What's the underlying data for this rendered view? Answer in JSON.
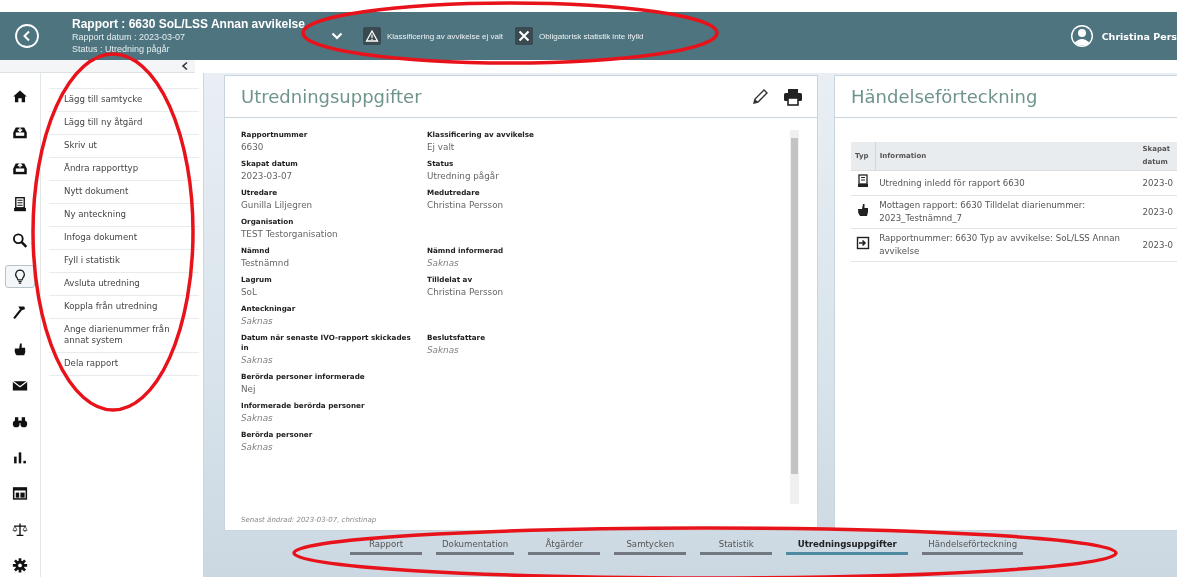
{
  "header": {
    "title": "Rapport : 6630 SoL/LSS Annan avvikelse",
    "subtitle_lines": [
      "Rapport datum : 2023-03-07",
      "Status : Utredning pågår"
    ],
    "alerts": [
      {
        "kind": "warning",
        "text": "Klassificering av avvikelse ej valt"
      },
      {
        "kind": "error",
        "text": "Obligatorisk statistik inte ifylld"
      }
    ],
    "user": "Christina Pers"
  },
  "rail": [
    {
      "selected": false
    },
    {
      "selected": false
    },
    {
      "selected": false
    },
    {
      "selected": false
    },
    {
      "selected": false
    },
    {
      "selected": true
    },
    {
      "selected": false
    },
    {
      "selected": false
    },
    {
      "selected": false
    },
    {
      "selected": false
    },
    {
      "selected": false
    },
    {
      "selected": false
    },
    {
      "selected": false
    },
    {
      "selected": false
    }
  ],
  "menu": [
    "Lägg till samtycke",
    "Lägg till ny åtgärd",
    "Skriv ut",
    "Ändra rapporttyp",
    "Nytt dokument",
    "Ny anteckning",
    "Infoga dokument",
    "Fyll i statistik",
    "Avsluta utredning",
    "Koppla från utredning",
    "Ange diarienummer från annat system",
    "Dela rapport"
  ],
  "details": {
    "title": "Utredningsuppgifter",
    "rows": [
      [
        {
          "label": "Rapportnummer",
          "value": "6630",
          "empty": false
        },
        {
          "label": "Klassificering av avvikelse",
          "value": "Ej valt",
          "empty": false
        }
      ],
      [
        {
          "label": "Skapat datum",
          "value": "2023-03-07",
          "empty": false
        },
        {
          "label": "Status",
          "value": "Utredning pågår",
          "empty": false
        }
      ],
      [
        {
          "label": "Utredare",
          "value": "Gunilla Liljegren",
          "empty": false
        },
        {
          "label": "Medutredare",
          "value": "Christina Persson",
          "empty": false
        }
      ],
      [
        {
          "label": "Organisation",
          "value": "TEST Testorganisation",
          "empty": false
        }
      ],
      [
        {
          "label": "Nämnd",
          "value": "Testnämnd",
          "empty": false
        },
        {
          "label": "Nämnd informerad",
          "value": "Saknas",
          "empty": true
        }
      ],
      [
        {
          "label": "Lagrum",
          "value": "SoL",
          "empty": false
        },
        {
          "label": "Tilldelat av",
          "value": "Christina Persson",
          "empty": false
        }
      ],
      [
        {
          "label": "Anteckningar",
          "value": "Saknas",
          "empty": true
        }
      ],
      [
        {
          "label": "Datum när senaste IVO-rapport skickades in",
          "value": "Saknas",
          "empty": true
        },
        {
          "label": "Beslutsfattare",
          "value": "Saknas",
          "empty": true
        }
      ],
      [
        {
          "label": "Berörda personer informerade",
          "value": "Nej",
          "empty": false
        }
      ],
      [
        {
          "label": "Informerade berörda personer",
          "value": "Saknas",
          "empty": true
        }
      ],
      [
        {
          "label": "Berörda personer",
          "value": "Saknas",
          "empty": true
        }
      ]
    ],
    "footer": "Senast ändrad: 2023-03-07, christinap"
  },
  "events": {
    "title": "Händelseförteckning",
    "table": {
      "columns": [
        "Typ",
        "Information",
        "Skapat datum"
      ],
      "rows": [
        {
          "kind": "document",
          "information": "Utredning inledd för rapport 6630",
          "date": "2023-0"
        },
        {
          "kind": "hand",
          "information": "Mottagen rapport: 6630 Tilldelat diarienummer: 2023_Testnämnd_7",
          "date": "2023-0"
        },
        {
          "kind": "enter",
          "information": "Rapportnummer: 6630 Typ av avvikelse: SoL/LSS Annan avvikelse",
          "date": "2023-0"
        }
      ]
    }
  },
  "tabs": [
    {
      "label": "Rapport",
      "selected": false
    },
    {
      "label": "Dokumentation",
      "selected": false
    },
    {
      "label": "Åtgärder",
      "selected": false
    },
    {
      "label": "Samtycken",
      "selected": false
    },
    {
      "label": "Statistik",
      "selected": false
    },
    {
      "label": "Utredningsuppgifter",
      "selected": true
    },
    {
      "label": "Händelseförteckning",
      "selected": false
    }
  ]
}
